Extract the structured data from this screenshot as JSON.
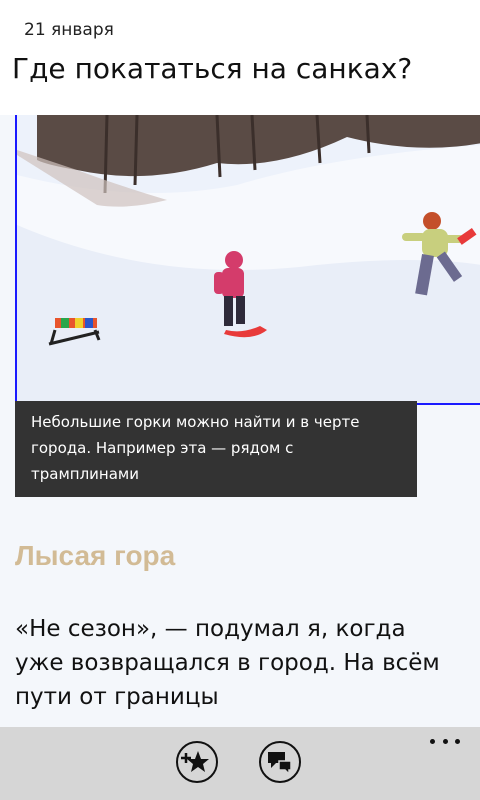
{
  "header": {
    "date": "21 января",
    "title": "Где покататься на санках?"
  },
  "article": {
    "photo_alt": "Дети катаются с горки на снегу",
    "caption": "Небольшие горки можно найти и в черте города. Например эта — рядом с трамплинами",
    "section_heading": "Лысая гора",
    "paragraph": "«Не сезон», — подумал я, когда уже возвращался в город. На всём пути от границы"
  },
  "appbar": {
    "buttons": [
      {
        "icon": "favorite-add-icon"
      },
      {
        "icon": "comments-icon"
      }
    ],
    "more_icon": "more-dots-icon"
  },
  "colors": {
    "accent_heading": "#d2bb95",
    "caption_bg": "#333333",
    "appbar_bg": "#d6d6d6",
    "photo_border": "#1a1aff"
  }
}
